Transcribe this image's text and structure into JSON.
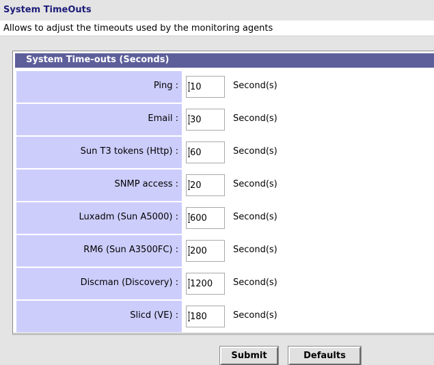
{
  "page": {
    "title": "System TimeOuts",
    "description": "Allows to adjust the timeouts used by the monitoring agents"
  },
  "section": {
    "header": "System Time-outs (Seconds)",
    "unit_label": "Second(s)",
    "rows": [
      {
        "label": "Ping :",
        "value": "10"
      },
      {
        "label": "Email :",
        "value": "30"
      },
      {
        "label": "Sun T3 tokens (Http) :",
        "value": "60"
      },
      {
        "label": "SNMP access :",
        "value": "20"
      },
      {
        "label": "Luxadm (Sun A5000) :",
        "value": "600"
      },
      {
        "label": "RM6 (Sun A3500FC) :",
        "value": "200"
      },
      {
        "label": "Discman (Discovery) :",
        "value": "1200"
      },
      {
        "label": "Slicd (VE) :",
        "value": "180"
      }
    ]
  },
  "actions": {
    "submit_label": "Submit",
    "defaults_label": "Defaults"
  },
  "colors": {
    "title_text": "#1c1c78",
    "section_header_bg": "#5d5f9a",
    "label_cell_bg": "#cdcdfc",
    "page_bg": "#e4e4e4"
  },
  "icons": {
    "field_cursor": "text-cursor-icon"
  }
}
